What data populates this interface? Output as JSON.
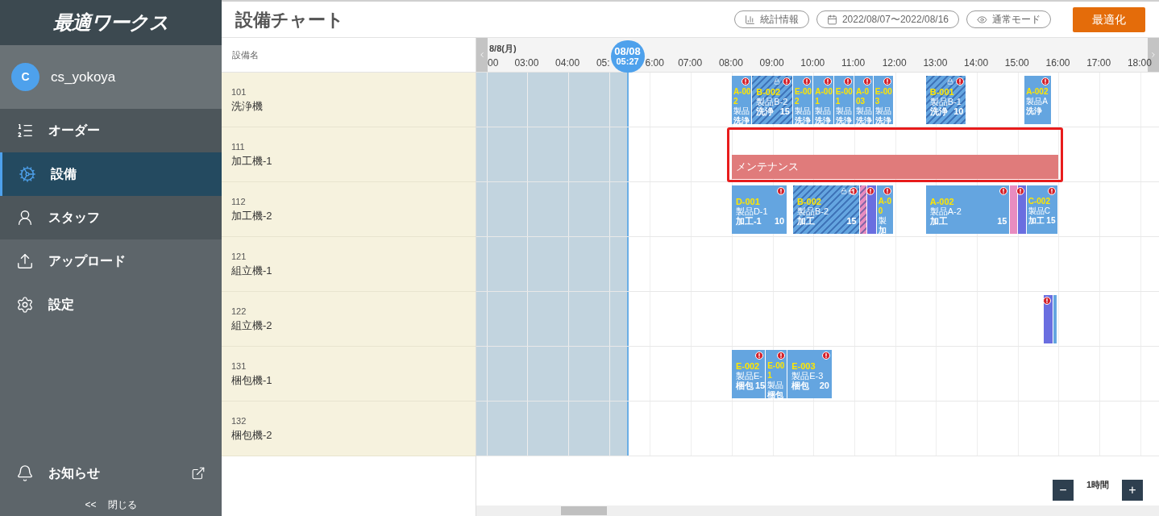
{
  "sidebar": {
    "logo": "最適ワークス",
    "user": {
      "initial": "C",
      "name": "cs_yokoya"
    },
    "items": [
      {
        "label": "オーダー",
        "selected": false
      },
      {
        "label": "設備",
        "selected": true
      },
      {
        "label": "スタッフ",
        "selected": false
      },
      {
        "label": "アップロード",
        "selected": false
      },
      {
        "label": "設定",
        "selected": false
      }
    ],
    "notice": "お知らせ",
    "collapse_icon": "<<",
    "collapse": "閉じる"
  },
  "header": {
    "title": "設備チャート",
    "buttons": [
      {
        "label": "統計情報"
      },
      {
        "label": "2022/08/07〜2022/08/16"
      },
      {
        "label": "通常モード"
      }
    ],
    "primary": "最適化"
  },
  "chart": {
    "column_title": "設備名",
    "date": "8/8(月)",
    "now": {
      "date": "08/08",
      "time": "05:27"
    },
    "hours": [
      {
        "label": "00",
        "kind": "cut_start"
      },
      {
        "label": "03:00",
        "kind": "full"
      },
      {
        "label": "04:00",
        "kind": "full"
      },
      {
        "label": "05:",
        "kind": "cut_end"
      },
      {
        "label": "6:00",
        "kind": "cut_start"
      },
      {
        "label": "07:00",
        "kind": "full"
      },
      {
        "label": "08:00",
        "kind": "full"
      },
      {
        "label": "09:00",
        "kind": "full"
      },
      {
        "label": "10:00",
        "kind": "full"
      },
      {
        "label": "11:00",
        "kind": "full"
      },
      {
        "label": "12:00",
        "kind": "full"
      },
      {
        "label": "13:00",
        "kind": "full"
      },
      {
        "label": "14:00",
        "kind": "full"
      },
      {
        "label": "15:00",
        "kind": "full"
      },
      {
        "label": "16:00",
        "kind": "full"
      },
      {
        "label": "17:00",
        "kind": "full"
      },
      {
        "label": "18:00",
        "kind": "full"
      }
    ],
    "rows": [
      {
        "id": "101",
        "name": "洗浄機",
        "blocks": [
          {
            "kind": "task",
            "color": "#64a5e0",
            "locked": false,
            "alert": true,
            "code": "A-002",
            "product": "製品",
            "process": "洗浄"
          },
          {
            "kind": "task",
            "color": "#64a5e0",
            "locked": true,
            "alert": true,
            "code": "B-002",
            "product": "製品B-2",
            "process": "洗浄",
            "qty": "15"
          },
          {
            "kind": "task",
            "color": "#64a5e0",
            "locked": false,
            "alert": true,
            "code": "E-002",
            "product": "製品",
            "process": "洗浄"
          },
          {
            "kind": "task",
            "color": "#64a5e0",
            "locked": false,
            "alert": true,
            "code": "A-001",
            "product": "製品",
            "process": "洗浄"
          },
          {
            "kind": "task",
            "color": "#64a5e0",
            "locked": false,
            "alert": true,
            "code": "E-001",
            "product": "製品",
            "process": "洗浄"
          },
          {
            "kind": "task",
            "color": "#64a5e0",
            "locked": false,
            "alert": true,
            "code": "A-003",
            "product": "製品",
            "process": "洗浄"
          },
          {
            "kind": "task",
            "color": "#64a5e0",
            "locked": false,
            "alert": true,
            "code": "E-003",
            "product": "製品",
            "process": "洗浄"
          },
          {
            "kind": "task",
            "color": "#64a5e0",
            "locked": true,
            "alert": true,
            "code": "B-001",
            "product": "製品B-1",
            "process": "洗浄",
            "qty": "10"
          },
          {
            "kind": "task",
            "color": "#64a5e0",
            "locked": false,
            "alert": true,
            "code": "A-002",
            "product": "製品A",
            "process": "洗浄"
          }
        ]
      },
      {
        "id": "111",
        "name": "加工機-1",
        "blocks": [
          {
            "kind": "maintenance",
            "color": "#e07b7b",
            "label": "メンテナンス",
            "highlighted": true
          }
        ]
      },
      {
        "id": "112",
        "name": "加工機-2",
        "blocks": [
          {
            "kind": "task",
            "color": "#64a5e0",
            "locked": false,
            "alert": true,
            "code": "D-001",
            "product": "製品D-1",
            "process": "加工-1",
            "qty": "10"
          },
          {
            "kind": "task",
            "color": "#64a5e0",
            "locked": true,
            "alert": true,
            "code": "B-002",
            "product": "製品B-2",
            "process": "加工",
            "qty": "15"
          },
          {
            "kind": "task",
            "color": "#e88cc0",
            "locked": true,
            "alert": false
          },
          {
            "kind": "task",
            "color": "#6a6ee0",
            "locked": false,
            "alert": true
          },
          {
            "kind": "task",
            "color": "#64a5e0",
            "locked": false,
            "alert": true,
            "code": "A-00",
            "product": "製",
            "process": "加"
          },
          {
            "kind": "task",
            "color": "#64a5e0",
            "locked": false,
            "alert": true,
            "code": "A-002",
            "product": "製品A-2",
            "process": "加工",
            "qty": "15"
          },
          {
            "kind": "task",
            "color": "#e88cc0",
            "locked": false,
            "alert": false
          },
          {
            "kind": "task",
            "color": "#6a6ee0",
            "locked": false,
            "alert": true
          },
          {
            "kind": "task",
            "color": "#64a5e0",
            "locked": false,
            "alert": true,
            "code": "C-002",
            "product": "製品C",
            "process": "加工",
            "qty": "15"
          }
        ]
      },
      {
        "id": "121",
        "name": "組立機-1",
        "blocks": []
      },
      {
        "id": "122",
        "name": "組立機-2",
        "blocks": [
          {
            "kind": "task",
            "color": "#6a6ee0",
            "locked": false,
            "alert": true
          },
          {
            "kind": "task",
            "color": "#64a5e0",
            "locked": false,
            "alert": false
          }
        ]
      },
      {
        "id": "131",
        "name": "梱包機-1",
        "blocks": [
          {
            "kind": "task",
            "color": "#64a5e0",
            "locked": false,
            "alert": true,
            "code": "E-002",
            "product": "製品E-",
            "process": "梱包",
            "qty": "15"
          },
          {
            "kind": "task",
            "color": "#64a5e0",
            "locked": false,
            "alert": true,
            "code": "E-001",
            "product": "製品",
            "process": "梱包"
          },
          {
            "kind": "task",
            "color": "#64a5e0",
            "locked": false,
            "alert": true,
            "code": "E-003",
            "product": "製品E-3",
            "process": "梱包",
            "qty": "20"
          }
        ]
      },
      {
        "id": "132",
        "name": "梱包機-2",
        "blocks": []
      }
    ]
  },
  "zoom": {
    "minus": "−",
    "label": "1時間",
    "plus": "+"
  }
}
